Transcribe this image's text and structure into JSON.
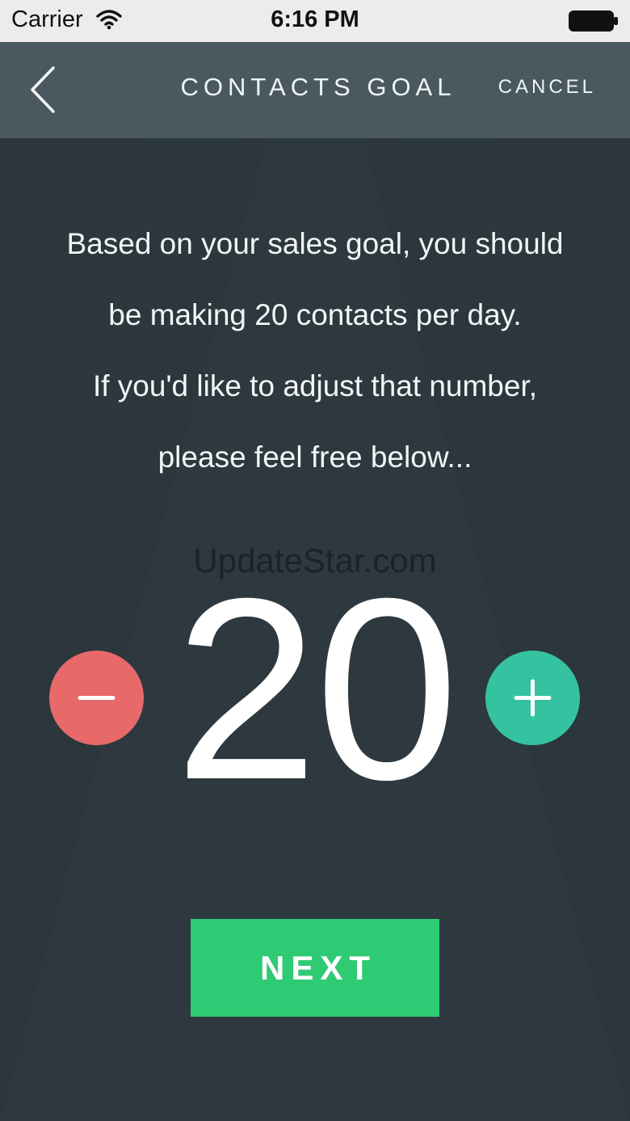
{
  "status_bar": {
    "carrier": "Carrier",
    "time": "6:16 PM",
    "icons": [
      "wifi-icon",
      "battery-icon"
    ]
  },
  "nav": {
    "back_icon": "chevron-left-icon",
    "title": "CONTACTS GOAL",
    "cancel_label": "CANCEL"
  },
  "message": {
    "lines": [
      "Based on your sales goal, you should",
      "be making 20 contacts per day.",
      "If you'd like to adjust that number,",
      "please feel free below..."
    ]
  },
  "watermark": "UpdateStar.com",
  "goal": {
    "value": "20",
    "decrement_icon": "minus-icon",
    "increment_icon": "plus-icon"
  },
  "next_label": "NEXT",
  "colors": {
    "background": "#2b373d",
    "nav_bar": "#49595f",
    "minus": "#e8696a",
    "plus": "#35c2a0",
    "next": "#2fca74"
  }
}
